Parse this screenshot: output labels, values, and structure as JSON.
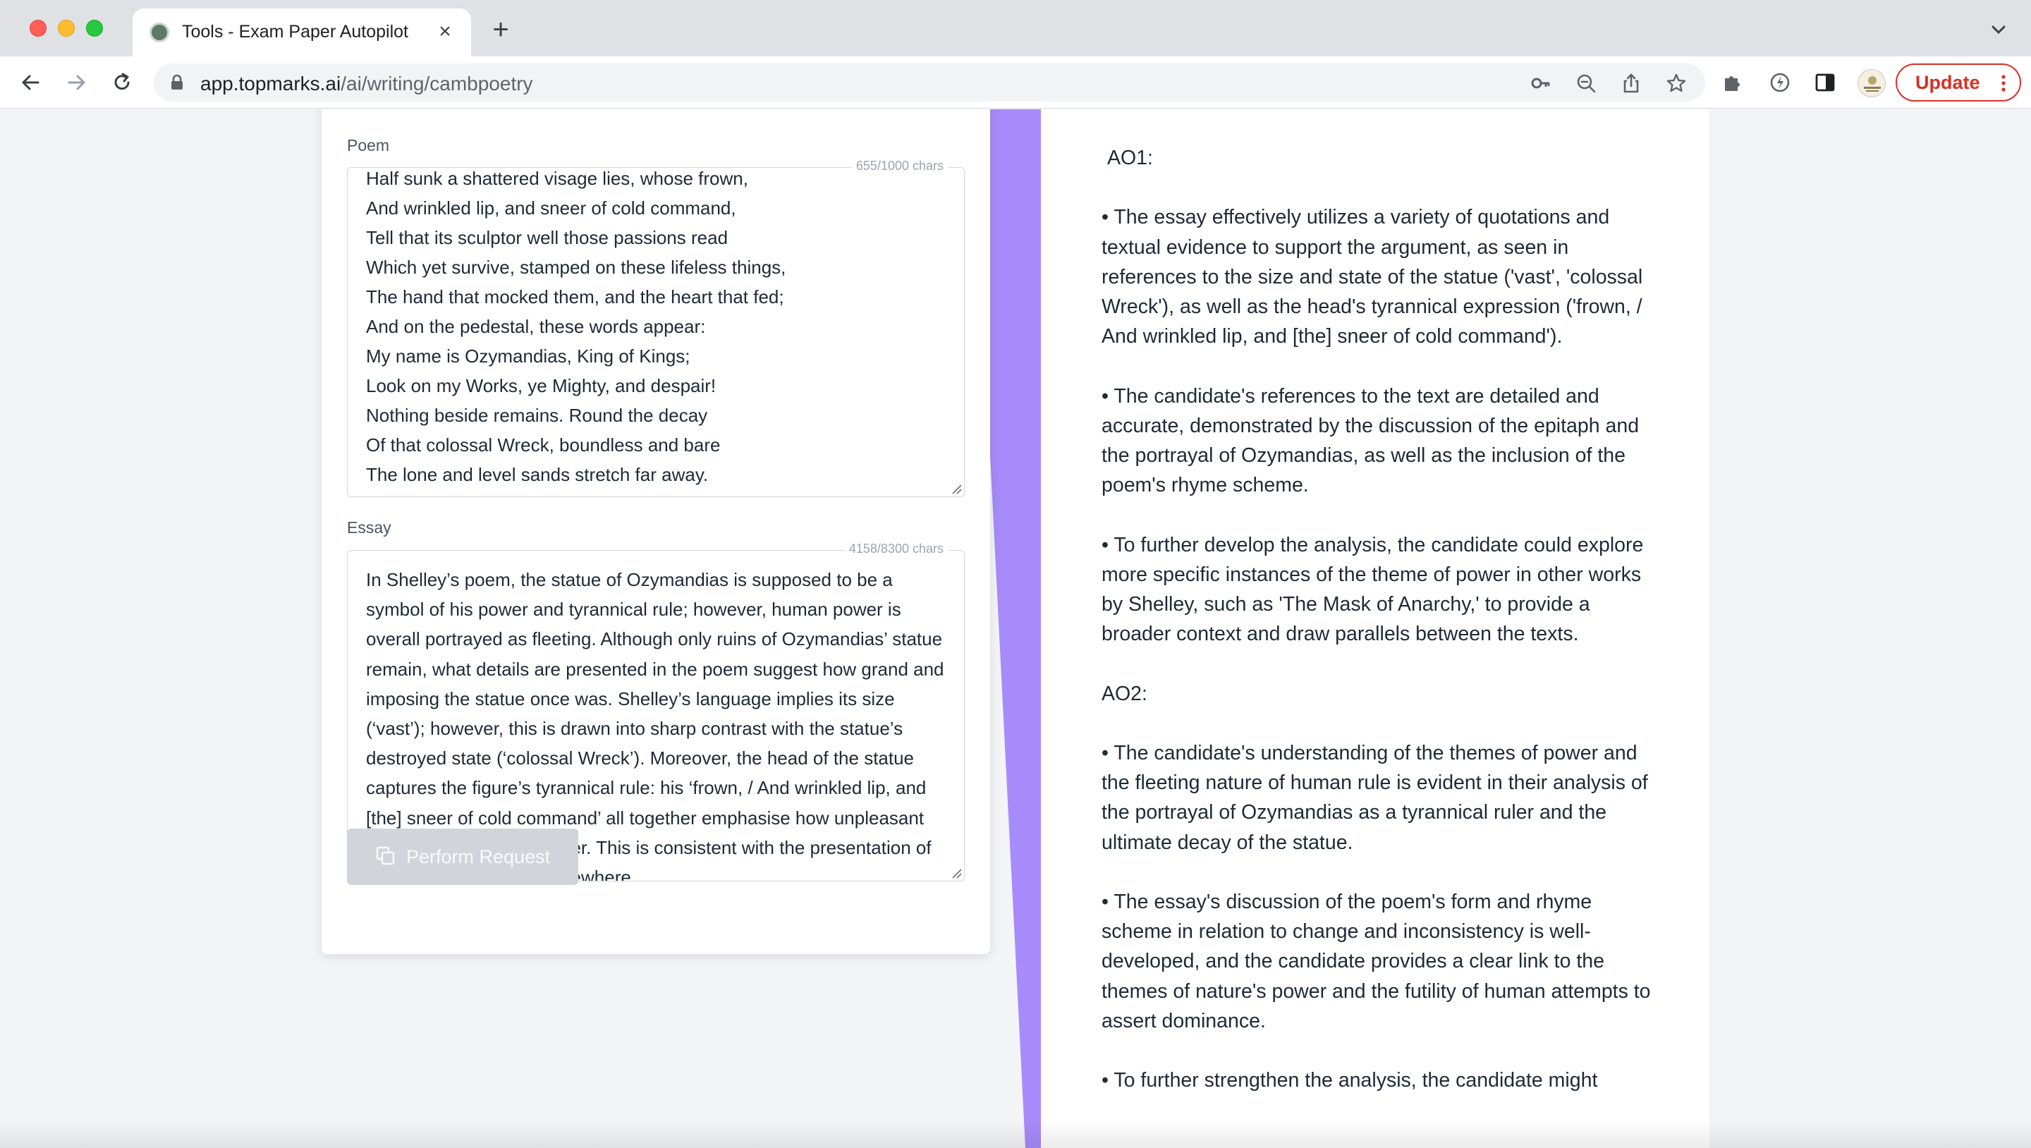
{
  "browser": {
    "tab_title": "Tools - Exam Paper Autopilot",
    "url_host": "app.topmarks.ai",
    "url_path": "/ai/writing/cambpoetry",
    "update_label": "Update"
  },
  "form": {
    "poem_label": "Poem",
    "poem_count": "655/1000 chars",
    "poem_lines": [
      "Half sunk a shattered visage lies, whose frown,",
      "And wrinkled lip, and sneer of cold command,",
      "Tell that its sculptor well those passions read",
      "Which yet survive, stamped on these lifeless things,",
      "The hand that mocked them, and the heart that fed;",
      "And on the pedestal, these words appear:",
      "My name is Ozymandias, King of Kings;",
      "Look on my Works, ye Mighty, and despair!",
      "Nothing beside remains. Round the decay",
      "Of that colossal Wreck, boundless and bare",
      "The lone and level sands stretch far away."
    ],
    "essay_label": "Essay",
    "essay_count": "4158/8300 chars",
    "essay_text": "In Shelley’s poem, the statue of Ozymandias is supposed to be a symbol of his power and tyrannical rule; however, human power is overall portrayed as fleeting. Although only ruins of Ozymandias’ statue remain, what details are presented in the poem suggest how grand and imposing the statue once was. Shelley’s language implies its size (‘vast’); however, this is drawn into sharp contrast with the statue’s destroyed state (‘colossal Wreck’). Moreover, the head of the statue captures the figure’s tyrannical rule: his ‘frown, / And wrinkled lip, and [the] sneer of cold command’ all together emphasise how unpleasant Ozymandias was as a ruler. This is consistent with the presentation of the Egyptian Pharaoh elsewhere",
    "submit_label": "Perform Request"
  },
  "results": {
    "ao1_heading": "AO1:",
    "ao1_points": [
      "• The essay effectively utilizes a variety of quotations and textual evidence to support the argument, as seen in references to the size and state of the statue ('vast', 'colossal Wreck'), as well as the head's tyrannical expression ('frown, / And wrinkled lip, and [the] sneer of cold command').",
      "• The candidate's references to the text are detailed and accurate, demonstrated by the discussion of the epitaph and the portrayal of Ozymandias, as well as the inclusion of the poem's rhyme scheme.",
      "• To further develop the analysis, the candidate could explore more specific instances of the theme of power in other works by Shelley, such as 'The Mask of Anarchy,' to provide a broader context and draw parallels between the texts."
    ],
    "ao2_heading": "AO2:",
    "ao2_points": [
      "• The candidate's understanding of the themes of power and the fleeting nature of human rule is evident in their analysis of the portrayal of Ozymandias as a tyrannical ruler and the ultimate decay of the statue.",
      "• The essay's discussion of the poem's form and rhyme scheme in relation to change and inconsistency is well-developed, and the candidate provides a clear link to the themes of nature's power and the futility of human attempts to assert dominance.",
      "• To further strengthen the analysis, the candidate might"
    ]
  },
  "colors": {
    "accent_purple": "#a78bfa",
    "update_red": "#d93025"
  }
}
